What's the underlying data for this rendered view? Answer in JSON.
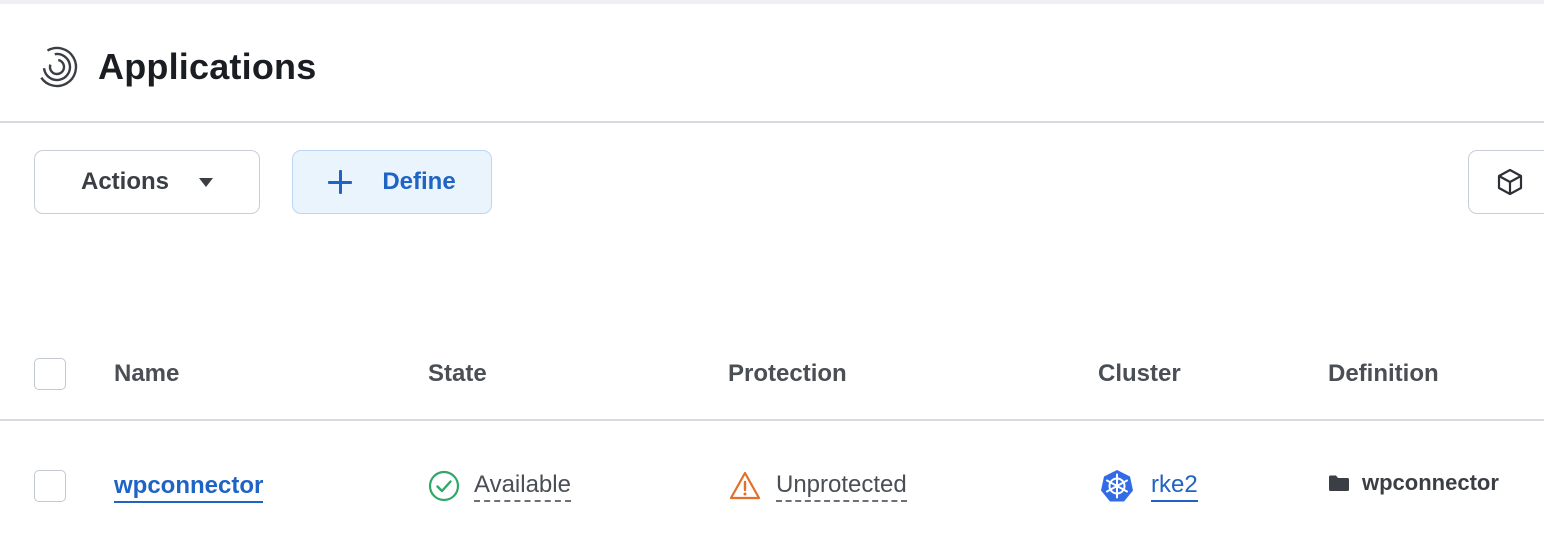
{
  "header": {
    "title": "Applications",
    "icon": "applications-icon"
  },
  "toolbar": {
    "actions_label": "Actions",
    "define_label": "Define",
    "cube_icon": "cube-icon"
  },
  "table": {
    "columns": [
      "Name",
      "State",
      "Protection",
      "Cluster",
      "Definition"
    ],
    "rows": [
      {
        "name": "wpconnector",
        "state": "Available",
        "protection": "Unprotected",
        "cluster": "rke2",
        "definition": "wpconnector"
      }
    ]
  },
  "colors": {
    "link": "#1f63c4",
    "available": "#2fa86a",
    "warning": "#e0702a",
    "kubernetes": "#326ce5"
  }
}
